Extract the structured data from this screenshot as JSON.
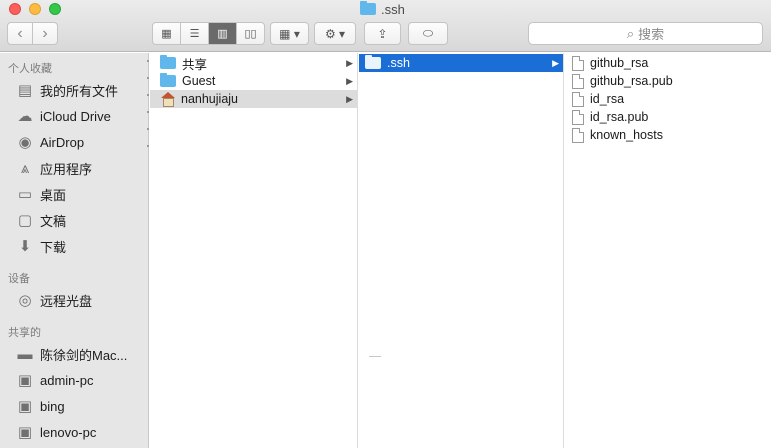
{
  "window": {
    "title": ".ssh"
  },
  "toolbar": {
    "back": "‹",
    "forward": "›",
    "view_icon": "▦",
    "view_list": "☰",
    "view_columns": "▥",
    "view_cover": "▯▯",
    "arrange": "▦ ▾",
    "action": "⚙ ▾",
    "share": "⇪",
    "tag": "⬭"
  },
  "search": {
    "icon": "⌕",
    "placeholder": "搜索"
  },
  "sidebar": {
    "sections": [
      {
        "header": "个人收藏",
        "items": [
          {
            "label": "我的所有文件",
            "icon": "all-files-icon"
          },
          {
            "label": "iCloud Drive",
            "icon": "cloud-icon"
          },
          {
            "label": "AirDrop",
            "icon": "airdrop-icon"
          },
          {
            "label": "应用程序",
            "icon": "applications-icon"
          },
          {
            "label": "桌面",
            "icon": "desktop-icon"
          },
          {
            "label": "文稿",
            "icon": "documents-icon"
          },
          {
            "label": "下载",
            "icon": "downloads-icon"
          }
        ]
      },
      {
        "header": "设备",
        "items": [
          {
            "label": "远程光盘",
            "icon": "remote-disc-icon"
          }
        ]
      },
      {
        "header": "共享的",
        "items": [
          {
            "label": "陈徐剑的Mac...",
            "icon": "computer-icon"
          },
          {
            "label": "admin-pc",
            "icon": "monitor-icon"
          },
          {
            "label": "bing",
            "icon": "monitor-icon"
          },
          {
            "label": "lenovo-pc",
            "icon": "monitor-icon"
          }
        ]
      }
    ]
  },
  "columns": {
    "col1": [
      {
        "label": "共享",
        "type": "folder",
        "has_children": true
      },
      {
        "label": "Guest",
        "type": "folder",
        "has_children": true
      },
      {
        "label": "nanhujiaju",
        "type": "home",
        "has_children": true,
        "selected": "inactive"
      }
    ],
    "col2": [
      {
        "label": ".ssh",
        "type": "folder",
        "has_children": true,
        "selected": "active"
      }
    ],
    "col3": [
      {
        "label": "github_rsa",
        "type": "file"
      },
      {
        "label": "github_rsa.pub",
        "type": "file"
      },
      {
        "label": "id_rsa",
        "type": "file"
      },
      {
        "label": "id_rsa.pub",
        "type": "file"
      },
      {
        "label": "known_hosts",
        "type": "file"
      }
    ],
    "chevron": "▶"
  },
  "colors": {
    "selection_active": "#1b6ed6",
    "selection_inactive": "#dcdcdc",
    "folder": "#5fb7ec",
    "sidebar_bg": "#e6e6e6"
  }
}
